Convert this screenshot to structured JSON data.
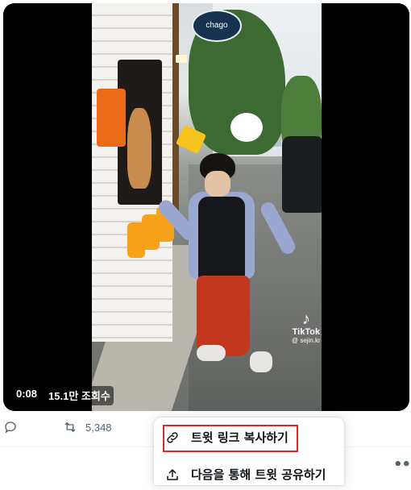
{
  "video": {
    "timestamp": "0:08",
    "views": "15.1만 조회수",
    "watermark": {
      "brand": "TikTok",
      "handle": "@ sejin.kr"
    },
    "shop_sign": "chago"
  },
  "actions": {
    "reply_icon": "reply-icon",
    "retweet_icon": "retweet-icon",
    "retweet_count": "5,348",
    "more_icon": "more-icon"
  },
  "share_menu": {
    "items": [
      {
        "icon": "link-icon",
        "label": "트윗 링크 복사하기",
        "highlighted": true
      },
      {
        "icon": "share-icon",
        "label": "다음을 통해 트윗 공유하기",
        "highlighted": false
      }
    ]
  },
  "colors": {
    "highlight": "#d12d2d",
    "icon": "#536471",
    "text": "#0f1419"
  }
}
